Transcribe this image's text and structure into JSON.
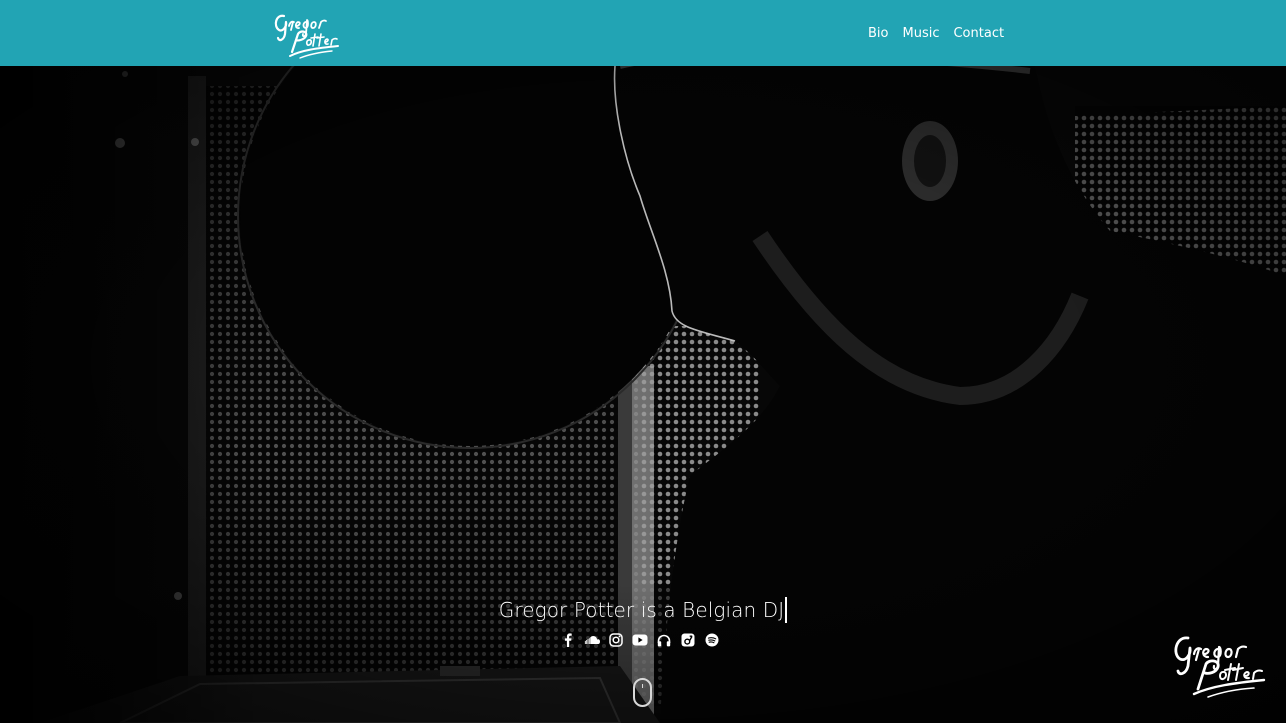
{
  "header": {
    "brand_color": "#22a4b4",
    "logo_alt": "Gregor Potter",
    "nav": [
      {
        "label": "Bio"
      },
      {
        "label": "Music"
      },
      {
        "label": "Contact"
      }
    ]
  },
  "hero": {
    "tagline": "Gregor Potter is a Belgian DJ",
    "socials": [
      {
        "icon": "facebook-icon"
      },
      {
        "icon": "soundcloud-icon"
      },
      {
        "icon": "instagram-icon"
      },
      {
        "icon": "youtube-icon"
      },
      {
        "icon": "headphones-icon"
      },
      {
        "icon": "beatport-icon"
      },
      {
        "icon": "spotify-icon"
      }
    ],
    "scroll_hint_icon": "mouse-scroll-icon",
    "corner_logo_alt": "Gregor Potter"
  }
}
